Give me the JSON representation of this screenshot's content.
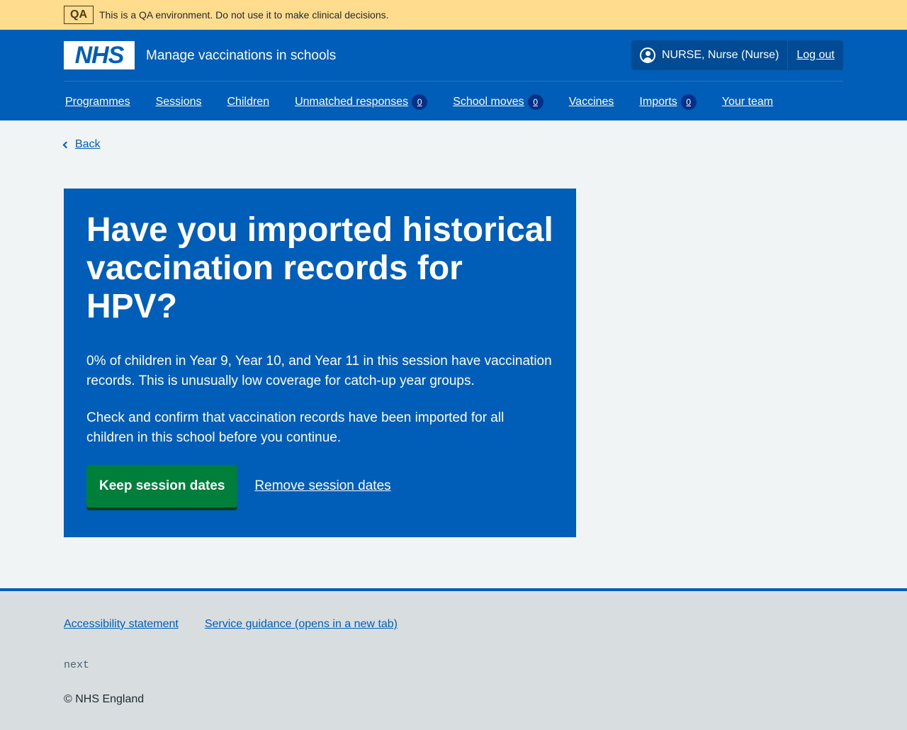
{
  "qa_banner": {
    "tag": "QA",
    "message": "This is a QA environment. Do not use it to make clinical decisions."
  },
  "header": {
    "logo_text": "NHS",
    "service_name": "Manage vaccinations in schools",
    "account": {
      "user_label": "NURSE, Nurse (Nurse)",
      "logout_label": "Log out"
    },
    "nav": [
      {
        "label": "Programmes"
      },
      {
        "label": "Sessions"
      },
      {
        "label": "Children"
      },
      {
        "label": "Unmatched responses",
        "count": "0"
      },
      {
        "label": "School moves",
        "count": "0"
      },
      {
        "label": "Vaccines"
      },
      {
        "label": "Imports",
        "count": "0"
      },
      {
        "label": "Your team"
      }
    ]
  },
  "back_link": "Back",
  "panel": {
    "heading": "Have you imported historical vaccination records for HPV?",
    "paragraph_1": "0% of children in Year 9, Year 10, and Year 11 in this session have vaccination records. This is unusually low coverage for catch-up year groups.",
    "paragraph_2": "Check and confirm that vaccination records have been imported for all children in this school before you continue.",
    "primary_button": "Keep session dates",
    "secondary_link": "Remove session dates"
  },
  "footer": {
    "links": [
      "Accessibility statement",
      "Service guidance (opens in a new tab)"
    ],
    "version": "next",
    "copyright": "© NHS England"
  },
  "colors": {
    "nhs_blue": "#005eb8",
    "qa_banner": "#ffdc8e",
    "button_green": "#007f3b",
    "page_background": "#f0f4f5",
    "footer_background": "#d8dde0"
  },
  "icons": {
    "user": "user-circle-icon",
    "back": "chevron-left-icon"
  }
}
